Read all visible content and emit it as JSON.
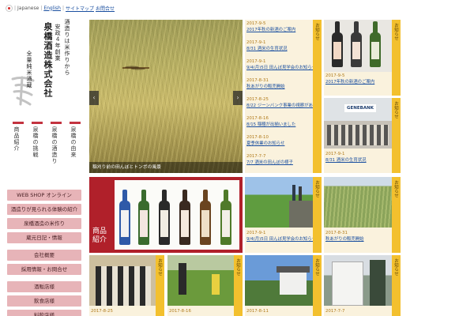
{
  "lang": {
    "current": "Japanese",
    "english": "English",
    "link2": "サイトマップ",
    "link3": "お問合せ"
  },
  "brand": {
    "name": "泉橋酒造株式会社",
    "tagline1": "酒造りは米作りから",
    "tagline2": "安政４年創業",
    "sub": "全量純米酒蔵"
  },
  "vnav": [
    "泉橋の由来",
    "泉橋の酒造り",
    "泉橋の挑戦",
    "商品紹介"
  ],
  "side_buttons": [
    "WEB SHOP オンライン",
    "酒造りが見られる体験の紹介",
    "泉橋酒造の米作り",
    "蔵元日記・情報",
    "会社概要",
    "採用情報・お問合せ",
    "酒販店様",
    "飲食店様",
    "料飲店様"
  ],
  "hero": {
    "caption": "稲刈り前の田んぼとトンボの風景"
  },
  "tab_label": "お知らせ",
  "news": [
    {
      "date": "2017-9-5",
      "title": "2017年秋の新酒のご案内"
    },
    {
      "date": "2017-9-1",
      "title": "8/31 酒米の生育状況"
    },
    {
      "date": "2017-9-1",
      "title": "9/4(月)5日 田んぼ見学会のお知らせです"
    },
    {
      "date": "2017-8-31",
      "title": "秋あがりの販売開始"
    },
    {
      "date": "2017-8-25",
      "title": "8/22 ジーンバンク事業の視察がありました"
    },
    {
      "date": "2017-8-16",
      "title": "8/15 稲穂が出揃いました"
    },
    {
      "date": "2017-8-10",
      "title": "夏季休業のお知らせ"
    },
    {
      "date": "2017-7-7",
      "title": "7/7 酒米の田んぼの様子"
    }
  ],
  "tiles": {
    "t1": {
      "date": "2017-9-5",
      "title": "2017年秋の新酒のご案内"
    },
    "t2": {
      "date": "2017-9-1",
      "title": "8/31 酒米の生育状況",
      "sign": "GENEBANK"
    },
    "t3": {
      "label": "商品紹介"
    },
    "t4": {
      "date": "2017-9-1",
      "title": "9/4(月)5日 田んぼ見学会のお知らせです"
    },
    "t5": {
      "date": "2017-8-31",
      "title": "秋あがりの販売開始"
    },
    "t6": {
      "date": "2017-8-25"
    },
    "t7": {
      "date": "2017-8-16"
    },
    "t8": {
      "date": "2017-8-11"
    },
    "t9": {
      "date": "2017-7-7"
    }
  },
  "colors": {
    "accent_red": "#c33340",
    "tab_yellow": "#f3c02e",
    "side_button": "#e7b4b8",
    "link_blue": "#1a4fa0",
    "date_orange": "#b07a1a"
  }
}
